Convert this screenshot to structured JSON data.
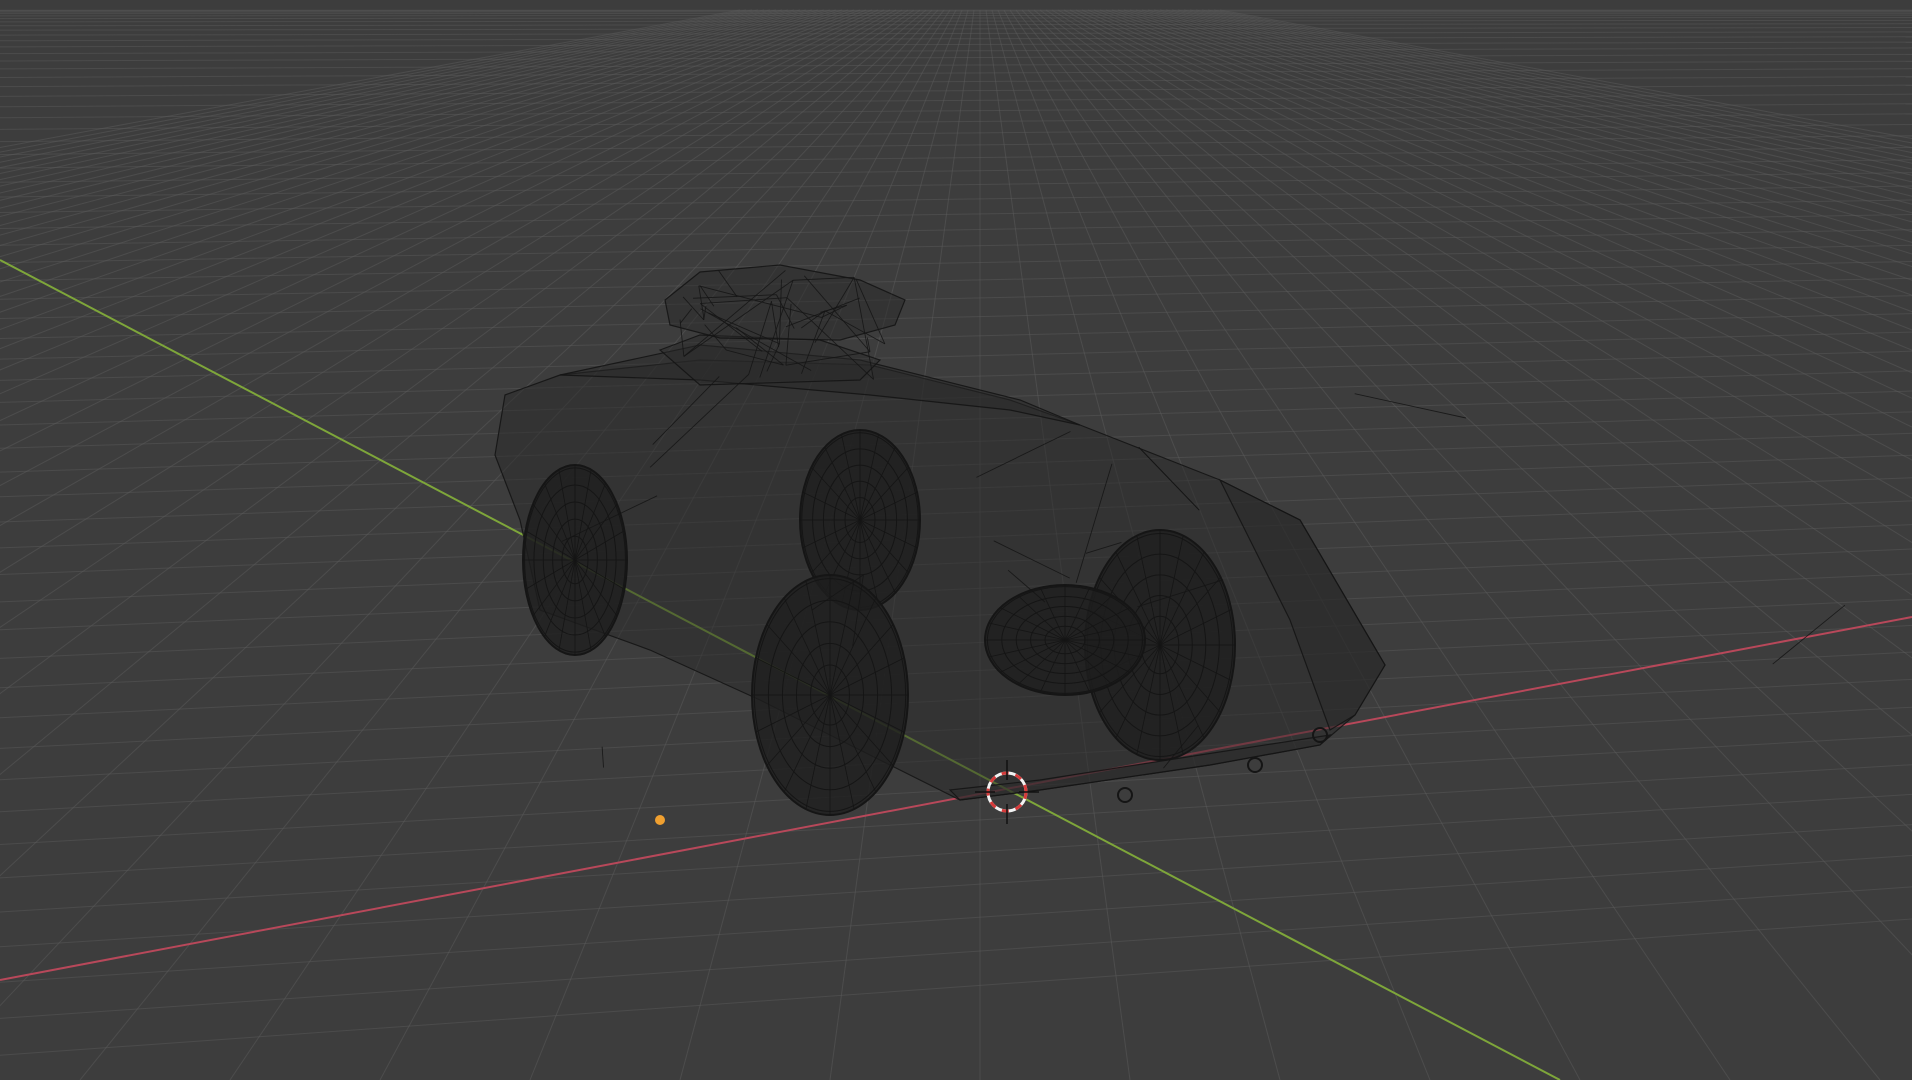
{
  "viewport": {
    "background": "#3d3d3d",
    "grid_color": "#5a5a5a",
    "x_axis_color": "#b8485a",
    "y_axis_color": "#7ea63a",
    "wire_color": "#151515",
    "cursor_red": "#d63a3a",
    "cursor_white": "#f2f2f2",
    "origin_dot": "#f0a030",
    "display_mode": "wireframe"
  },
  "scene": {
    "object": "armored-vehicle-mesh",
    "has_3d_cursor": true,
    "has_object_origin": true
  }
}
